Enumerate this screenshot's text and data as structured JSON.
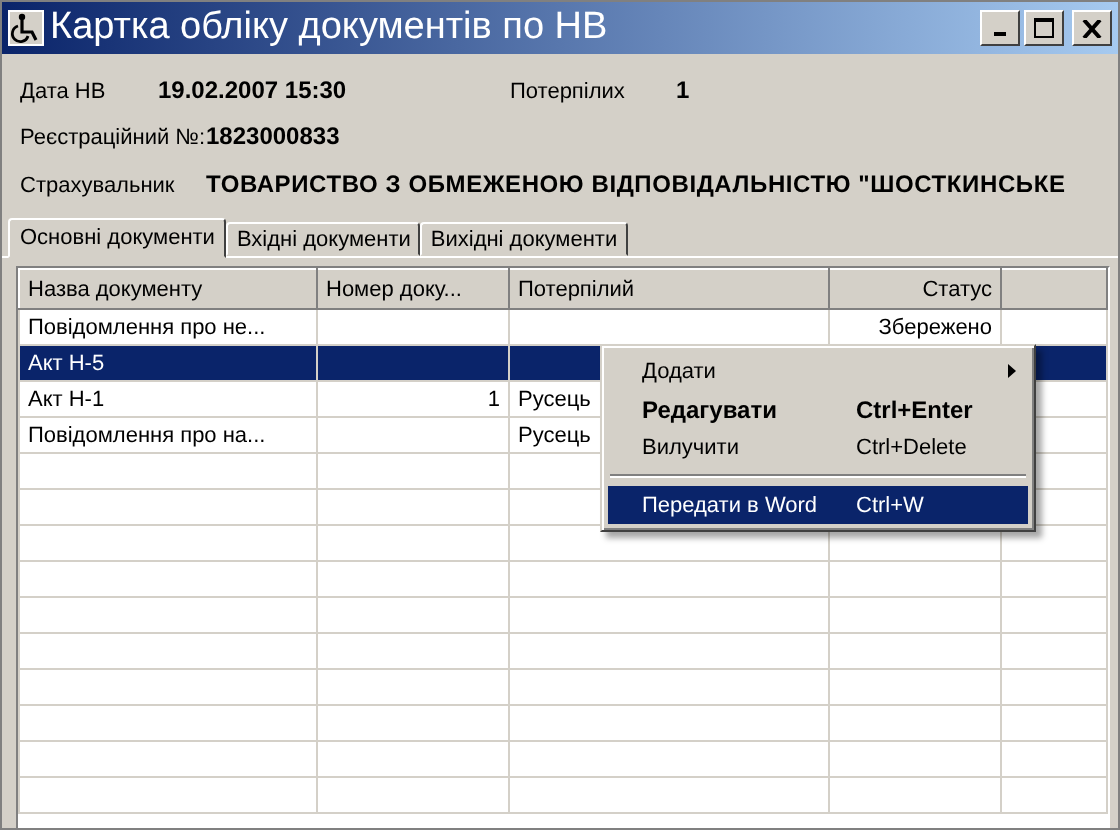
{
  "window": {
    "title": "Картка обліку документів по НВ"
  },
  "info": [
    {
      "label": "Дата НВ",
      "value": "19.02.2007 15:30"
    },
    {
      "label": "Потерпілих",
      "value": "1"
    },
    {
      "label": "Реєстраційний №:",
      "value": "1823000833"
    },
    {
      "label": "Страхувальник",
      "value": "ТОВАРИСТВО З ОБМЕЖЕНОЮ ВІДПОВІДАЛЬНІСТЮ \"ШОСТКИНСЬКЕ"
    }
  ],
  "tabs": [
    {
      "label": "Основні документи",
      "selected": true
    },
    {
      "label": "Вхідні документи",
      "selected": false
    },
    {
      "label": "Вихідні документи",
      "selected": false
    }
  ],
  "table": {
    "columns": [
      "Назва документу",
      "Номер доку...",
      "Потерпілий",
      "Статус"
    ],
    "rows": [
      {
        "cells": [
          "Повідомлення про не...",
          "",
          "",
          "Збережено"
        ],
        "selected": false
      },
      {
        "cells": [
          "Акт Н-5",
          "",
          "",
          ""
        ],
        "selected": true
      },
      {
        "cells": [
          "Акт Н-1",
          "1",
          "Русець",
          ""
        ],
        "selected": false
      },
      {
        "cells": [
          "Повідомлення про на...",
          "",
          "Русець",
          ""
        ],
        "selected": false
      }
    ]
  },
  "context_menu": [
    {
      "kind": "item",
      "label": "Додати",
      "submenu": true,
      "bold": false,
      "selected": false
    },
    {
      "kind": "item",
      "label": "Редагувати",
      "shortcut": "Ctrl+Enter",
      "bold": true,
      "selected": false
    },
    {
      "kind": "item",
      "label": "Вилучити",
      "shortcut": "Ctrl+Delete",
      "bold": false,
      "selected": false
    },
    {
      "kind": "separator"
    },
    {
      "kind": "item",
      "label": "Передати в Word",
      "shortcut": "Ctrl+W",
      "bold": false,
      "selected": true
    }
  ]
}
